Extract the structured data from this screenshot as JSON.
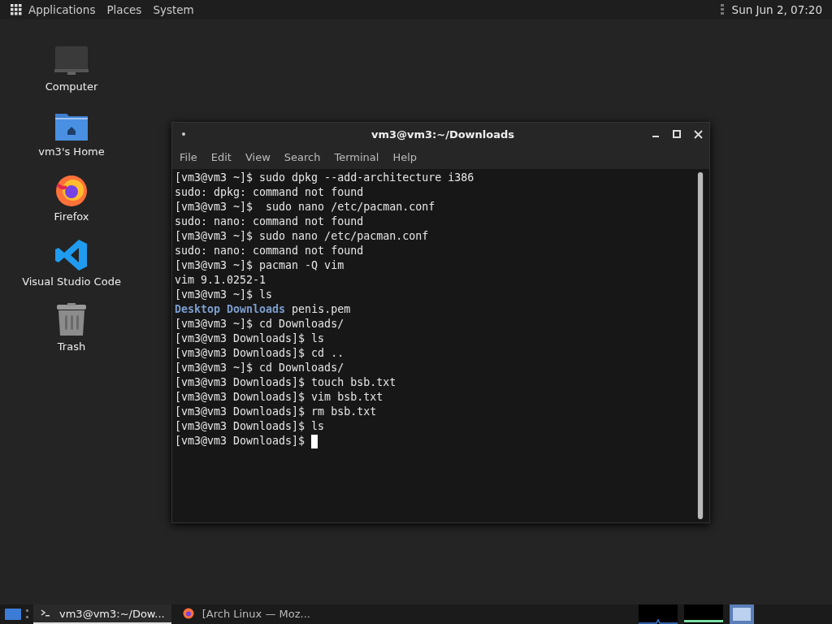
{
  "top_panel": {
    "menus": [
      "Applications",
      "Places",
      "System"
    ],
    "clock": "Sun Jun  2, 07:20"
  },
  "desktop_icons": [
    {
      "label": "Computer",
      "kind": "computer"
    },
    {
      "label": "vm3's Home",
      "kind": "home"
    },
    {
      "label": "Firefox",
      "kind": "firefox"
    },
    {
      "label": "Visual Studio Code",
      "kind": "vscode"
    },
    {
      "label": "Trash",
      "kind": "trash"
    }
  ],
  "window": {
    "title": "vm3@vm3:~/Downloads",
    "menu": [
      "File",
      "Edit",
      "View",
      "Search",
      "Terminal",
      "Help"
    ],
    "lines": [
      {
        "kind": "text",
        "text": "[vm3@vm3 ~]$ sudo dpkg --add-architecture i386"
      },
      {
        "kind": "text",
        "text": "sudo: dpkg: command not found"
      },
      {
        "kind": "text",
        "text": "[vm3@vm3 ~]$  sudo nano /etc/pacman.conf"
      },
      {
        "kind": "text",
        "text": "sudo: nano: command not found"
      },
      {
        "kind": "text",
        "text": "[vm3@vm3 ~]$ sudo nano /etc/pacman.conf"
      },
      {
        "kind": "text",
        "text": "sudo: nano: command not found"
      },
      {
        "kind": "text",
        "text": "[vm3@vm3 ~]$ pacman -Q vim"
      },
      {
        "kind": "text",
        "text": "vim 9.1.0252-1"
      },
      {
        "kind": "text",
        "text": "[vm3@vm3 ~]$ ls"
      },
      {
        "kind": "listing",
        "items": [
          {
            "text": "Desktop",
            "kind": "dir"
          },
          {
            "text": "Downloads",
            "kind": "dir"
          },
          {
            "text": "penis.pem",
            "kind": "file"
          }
        ]
      },
      {
        "kind": "text",
        "text": "[vm3@vm3 ~]$ cd Downloads/"
      },
      {
        "kind": "text",
        "text": "[vm3@vm3 Downloads]$ ls"
      },
      {
        "kind": "text",
        "text": "[vm3@vm3 Downloads]$ cd .."
      },
      {
        "kind": "text",
        "text": "[vm3@vm3 ~]$ cd Downloads/"
      },
      {
        "kind": "text",
        "text": "[vm3@vm3 Downloads]$ touch bsb.txt"
      },
      {
        "kind": "text",
        "text": "[vm3@vm3 Downloads]$ vim bsb.txt"
      },
      {
        "kind": "text",
        "text": "[vm3@vm3 Downloads]$ rm bsb.txt"
      },
      {
        "kind": "text",
        "text": "[vm3@vm3 Downloads]$ ls"
      },
      {
        "kind": "prompt",
        "text": "[vm3@vm3 Downloads]$"
      }
    ]
  },
  "taskbar": {
    "tasks": [
      {
        "label": "vm3@vm3:~/Dow...",
        "kind": "terminal",
        "selected": true
      },
      {
        "label": "[Arch Linux — Moz...",
        "kind": "firefox",
        "selected": false
      }
    ],
    "workspaces": [
      {
        "selected": true
      }
    ]
  }
}
